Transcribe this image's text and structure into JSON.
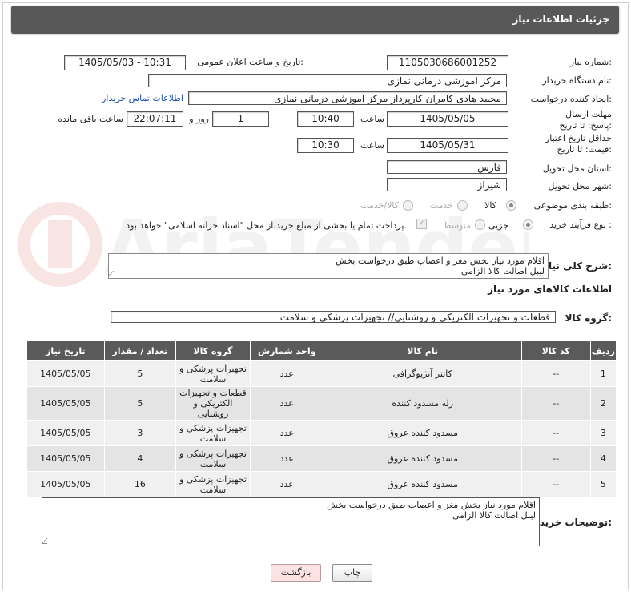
{
  "header": {
    "title": "جزئیات اطلاعات نیاز"
  },
  "labels": {
    "need_number": "شماره نیاز:",
    "announce_datetime": "تاریخ و ساعت اعلان عمومی:",
    "buyer_org": "نام دستگاه خریدار:",
    "requester": "ایجاد کننده درخواست:",
    "contact_link": "اطلاعات تماس خریدار",
    "reply_deadline": "مهلت ارسال پاسخ: تا تاریخ:",
    "time": "ساعت",
    "day_and": "روز و",
    "hours_remaining": "ساعت باقی مانده",
    "price_validity": "حداقل تاریخ اعتبار قیمت: تا تاریخ:",
    "province": "استان محل تحویل:",
    "city": "شهر محل تحویل:",
    "category": "طبقه بندی موضوعی:",
    "process_type": "نوع فرآیند خرید :",
    "description": "شرح کلی نیاز:",
    "goods_info": "اطلاعات کالاهای مورد نیاز",
    "goods_group": "گروه کالا:",
    "buyer_notes": "توضیحات خریدار:"
  },
  "fields": {
    "need_number": "1105030686001252",
    "announce_datetime": "1405/05/03 - 10:31",
    "buyer_org": "مرکز اموزشی درمانی نمازی",
    "requester": "محمد هادی کامران کارپرداز مرکز اموزشی درمانی نمازی",
    "reply_date": "1405/05/05",
    "reply_time": "10:40",
    "days": "1",
    "remaining_time": "22:07:11",
    "price_date": "1405/05/31",
    "price_time": "10:30",
    "province": "فارس",
    "city": "شیراز",
    "goods_group": "قطعات و تجهیزات الکتریکی و روشنایی// تجهیزات پزشکی و سلامت"
  },
  "category_options": [
    "کالا",
    "خدمت",
    "کالا/خدمت"
  ],
  "category_selected": "کالا",
  "process_options": [
    "جزیی",
    "متوسط"
  ],
  "process_selected": "جزیی",
  "payment_note": "پرداخت تمام یا بخشی از مبلغ خرید،از محل \"اسناد خزانه اسلامی\" خواهد بود.",
  "description_text": "اقلام مورد نیاز بخش مغز و اعصاب طبق درخواست بخش\nلیبل اصالت کالا الزامی",
  "buyer_notes_text": "اقلام مورد نیاز بخش مغز و اعصاب طبق درخواست بخش\nلیبل اصالت کالا الزامی",
  "table": {
    "columns": [
      "ردیف",
      "کد کالا",
      "نام کالا",
      "واحد شمارش",
      "گروه کالا",
      "تعداد / مقدار",
      "تاریخ نیاز"
    ],
    "rows": [
      [
        "1",
        "--",
        "کاتتر آنژیوگرافی",
        "عدد",
        "تجهیزات پزشکی و سلامت",
        "5",
        "1405/05/05"
      ],
      [
        "2",
        "--",
        "رله مسدود کننده",
        "عدد",
        "قطعات و تجهیزات الکتریکی و روشنایی",
        "5",
        "1405/05/05"
      ],
      [
        "3",
        "--",
        "مسدود کننده عروق",
        "عدد",
        "تجهیزات پزشکی و سلامت",
        "3",
        "1405/05/05"
      ],
      [
        "4",
        "--",
        "مسدود کننده عروق",
        "عدد",
        "تجهیزات پزشکی و سلامت",
        "4",
        "1405/05/05"
      ],
      [
        "5",
        "--",
        "مسدود کننده عروق",
        "عدد",
        "تجهیزات پزشکی و سلامت",
        "16",
        "1405/05/05"
      ]
    ]
  },
  "buttons": {
    "print": "چاپ",
    "back": "بازگشت"
  },
  "watermark": "AriaTender.net"
}
